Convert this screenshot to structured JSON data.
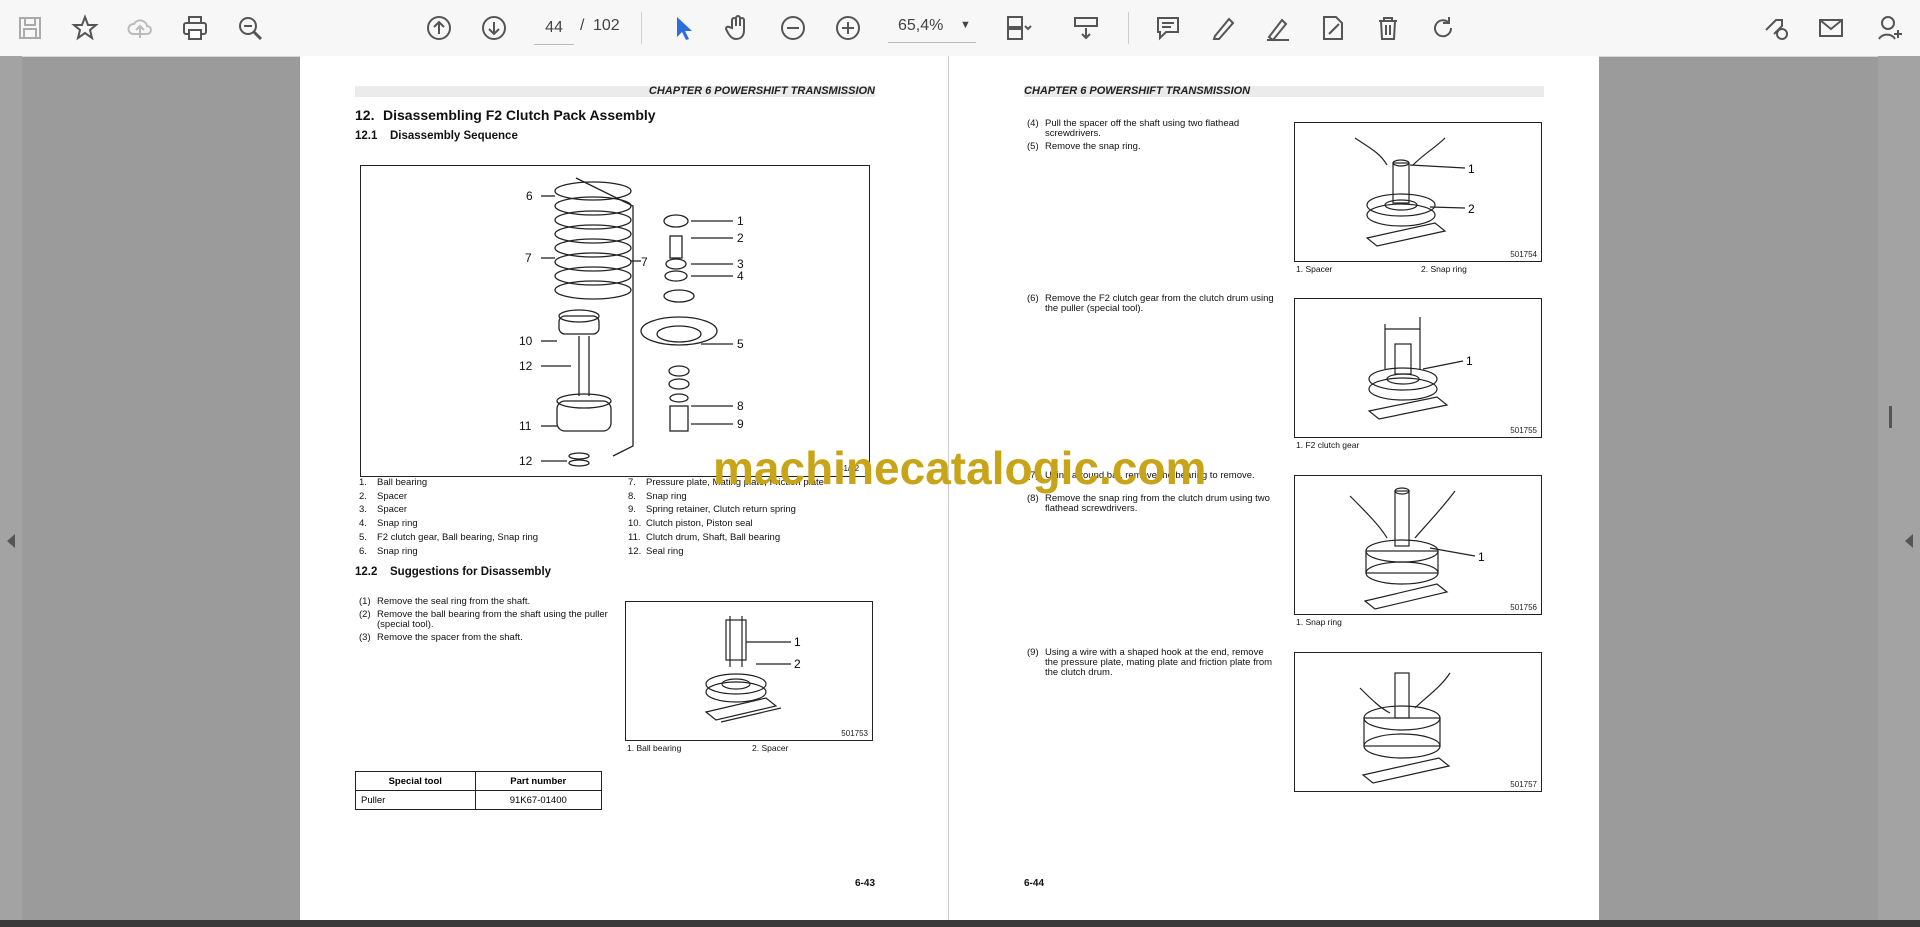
{
  "toolbar": {
    "icons": [
      "save-icon",
      "bookmark-star-icon",
      "upload-cloud-icon",
      "print-icon",
      "zoom-search-icon",
      "page-up-icon",
      "page-down-icon",
      "select-cursor-icon",
      "hand-tool-icon",
      "zoom-out-icon",
      "zoom-in-icon",
      "fit-page-icon",
      "scroll-mode-icon",
      "comment-icon",
      "highlight-pen-icon",
      "draw-sign-icon",
      "edit-doc-icon",
      "delete-icon",
      "rotate-icon",
      "share-link-icon",
      "email-icon",
      "user-add-icon"
    ],
    "current_page": "44",
    "page_separator": "/",
    "total_pages": "102",
    "zoom": "65,4%"
  },
  "left_page": {
    "chapter": "CHAPTER 6 POWERSHIFT TRANSMISSION",
    "section_number": "12.",
    "section_title": "Disassembling F2 Clutch Pack Assembly",
    "sub1_number": "12.1",
    "sub1_title": "Disassembly Sequence",
    "diagram_callouts": [
      "6",
      "7",
      "7",
      "10",
      "12",
      "11",
      "12",
      "1",
      "2",
      "3",
      "4",
      "5",
      "8",
      "9"
    ],
    "diagram_code": "41/52",
    "parts_left": [
      {
        "n": "1.",
        "t": "Ball bearing"
      },
      {
        "n": "2.",
        "t": "Spacer"
      },
      {
        "n": "3.",
        "t": "Spacer"
      },
      {
        "n": "4.",
        "t": "Snap ring"
      },
      {
        "n": "5.",
        "t": "F2 clutch gear, Ball bearing, Snap ring"
      },
      {
        "n": "6.",
        "t": "Snap ring"
      }
    ],
    "parts_right": [
      {
        "n": "7.",
        "t": "Pressure plate, Mating plate, Friction plate"
      },
      {
        "n": "8.",
        "t": "Snap ring"
      },
      {
        "n": "9.",
        "t": "Spring retainer, Clutch return spring"
      },
      {
        "n": "10.",
        "t": "Clutch piston, Piston seal"
      },
      {
        "n": "11.",
        "t": "Clutch drum, Shaft, Ball bearing"
      },
      {
        "n": "12.",
        "t": "Seal ring"
      }
    ],
    "sub2_number": "12.2",
    "sub2_title": "Suggestions for Disassembly",
    "steps": [
      {
        "n": "(1)",
        "t": "Remove the seal ring from the shaft."
      },
      {
        "n": "(2)",
        "t": "Remove the ball bearing from the shaft using the puller (special tool)."
      },
      {
        "n": "(3)",
        "t": "Remove the spacer from the shaft."
      }
    ],
    "figure": {
      "code": "501753",
      "callouts": [
        "1",
        "2"
      ],
      "caption1": "1. Ball bearing",
      "caption2": "2. Spacer"
    },
    "table": {
      "headers": [
        "Special tool",
        "Part number"
      ],
      "rows": [
        [
          "Puller",
          "91K67-01400"
        ]
      ]
    },
    "page_number": "6-43"
  },
  "right_page": {
    "chapter": "CHAPTER 6 POWERSHIFT TRANSMISSION",
    "steps_a": [
      {
        "n": "(4)",
        "t": "Pull the spacer off the shaft using two flathead screwdrivers."
      },
      {
        "n": "(5)",
        "t": "Remove the snap ring."
      }
    ],
    "fig1": {
      "code": "501754",
      "callouts": [
        "1",
        "2"
      ],
      "caption1": "1. Spacer",
      "caption2": "2. Snap ring"
    },
    "steps_b": [
      {
        "n": "(6)",
        "t": "Remove the F2 clutch gear from the clutch drum using the puller (special tool)."
      }
    ],
    "fig2": {
      "code": "501755",
      "callouts": [
        "1"
      ],
      "caption1": "1. F2 clutch gear"
    },
    "steps_c": [
      {
        "n": "(7)",
        "t": "Using a round bar, remove the bearing to remove."
      },
      {
        "n": "(8)",
        "t": "Remove the snap ring from the clutch drum using two flathead screwdrivers."
      }
    ],
    "fig3": {
      "code": "501756",
      "callouts": [
        "1"
      ],
      "caption1": "1. Snap ring"
    },
    "steps_d": [
      {
        "n": "(9)",
        "t": "Using a wire with a shaped hook at the end, remove the pressure plate, mating plate and friction plate from the clutch drum."
      }
    ],
    "fig4": {
      "code": "501757"
    },
    "page_number": "6-44"
  },
  "watermark": "machinecatalogic.com"
}
